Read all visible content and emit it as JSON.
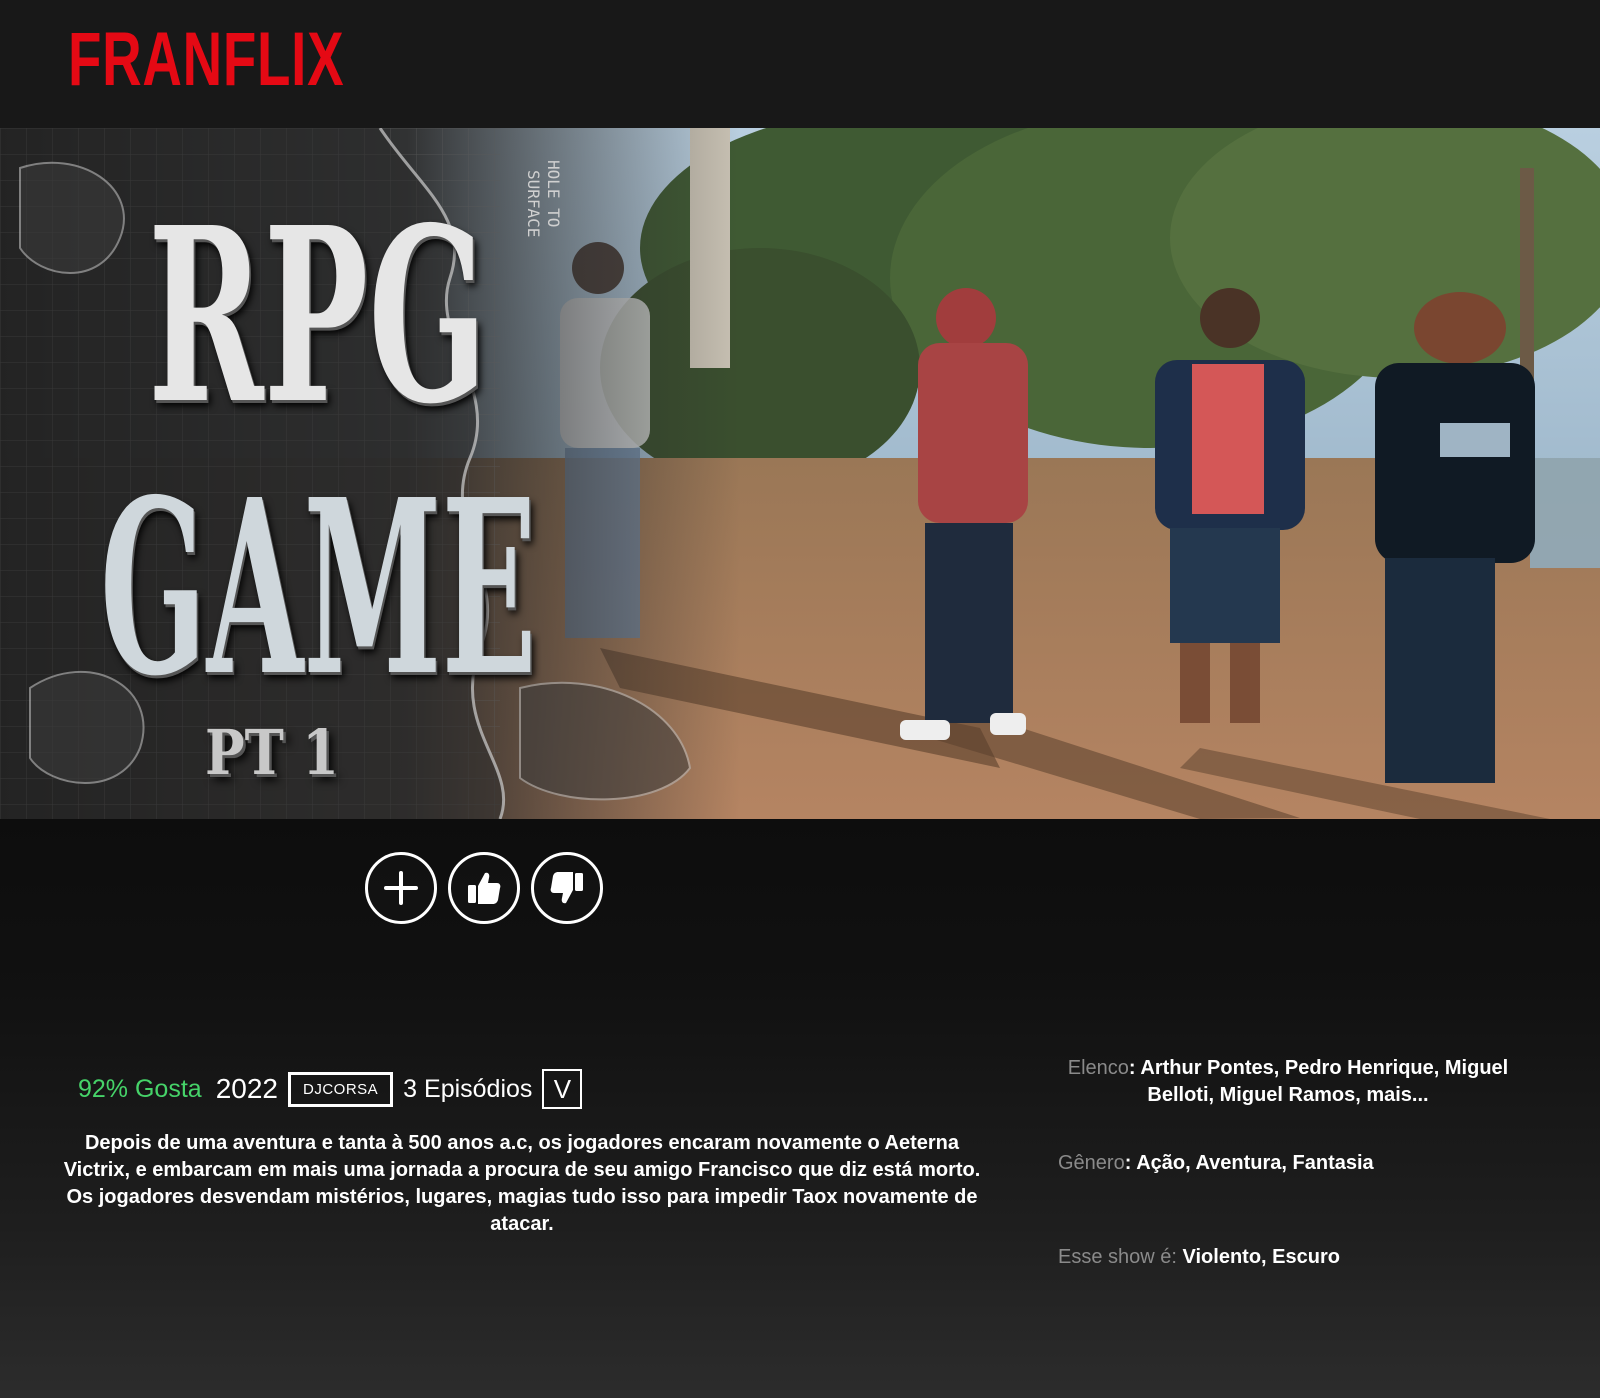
{
  "header": {
    "logo_text": "FRANFLIX",
    "logo_color": "#e50914"
  },
  "hero": {
    "title_line1": "RPG",
    "title_line2": "GAME",
    "title_part": "PT 1",
    "map_labels": [
      "HOLE TO",
      "SURFACE"
    ]
  },
  "actions": {
    "add_icon": "plus-icon",
    "like_icon": "thumbs-up-icon",
    "dislike_icon": "thumbs-down-icon"
  },
  "info": {
    "match": "92% Gosta",
    "match_color": "#46d369",
    "year": "2022",
    "rating_badge": "DJCORSA",
    "episodes": "3 Episódios",
    "expand_label": "V",
    "description": "Depois de uma aventura e tanta à 500 anos a.c, os jogadores encaram novamente o Aeterna Victrix, e embarcam em mais uma jornada a procura de seu amigo Francisco que diz está morto. Os jogadores desvendam mistérios, lugares, magias tudo isso para impedir Taox novamente de atacar."
  },
  "details": {
    "cast_label": "Elenco",
    "cast_value": ": Arthur Pontes, Pedro Henrique, Miguel Belloti, Miguel Ramos, mais...",
    "genre_label": "Gênero",
    "genre_value": ": Ação, Aventura, Fantasia",
    "show_label": "Esse show é:",
    "show_value": " Violento, Escuro"
  }
}
